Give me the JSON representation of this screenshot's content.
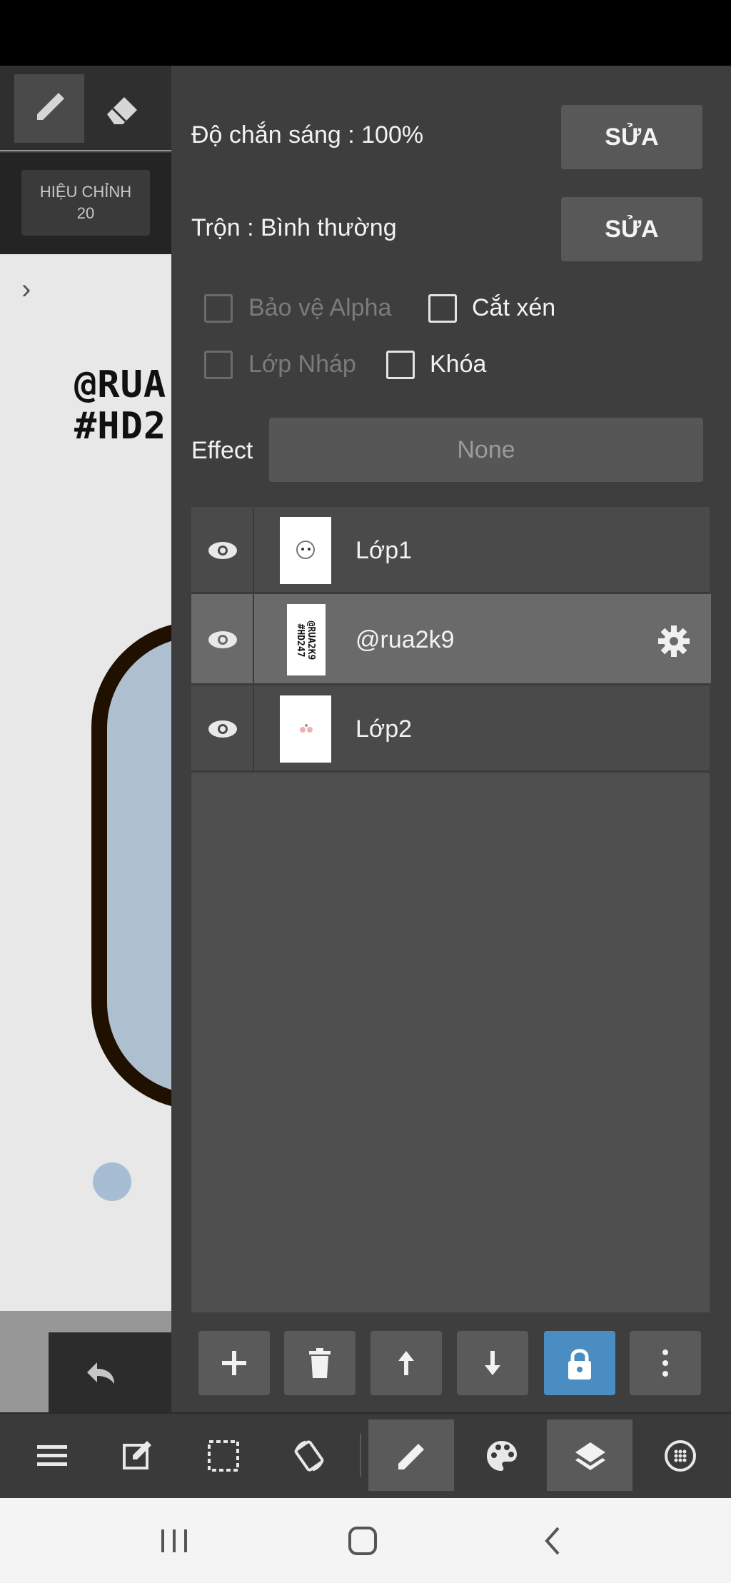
{
  "toolbar": {
    "correction_label": "HIỆU CHỈNH",
    "correction_value": "20"
  },
  "canvas": {
    "watermark_line1": "@RUA",
    "watermark_line2": "#HD2"
  },
  "layer_panel": {
    "opacity_label": "Độ chắn sáng : 100%",
    "opacity_edit": "SỬA",
    "blend_label": "Trộn : Bình thường",
    "blend_edit": "SỬA",
    "protect_alpha": "Bảo vệ Alpha",
    "clipping": "Cắt xén",
    "draft_layer": "Lớp Nháp",
    "lock": "Khóa",
    "effect_label": "Effect",
    "effect_value": "None"
  },
  "layers": [
    {
      "name": "Lớp1",
      "visible": true,
      "selected": false
    },
    {
      "name": "@rua2k9",
      "visible": true,
      "selected": true,
      "thumb_text": "@RUA2K9 #HD247"
    },
    {
      "name": "Lớp2",
      "visible": true,
      "selected": false
    }
  ],
  "colors": {
    "panel_bg": "#3e3e3e",
    "active_lock": "#4a8dc2"
  },
  "icons": {
    "layer_actions": [
      "plus-icon",
      "trash-icon",
      "arrow-up-icon",
      "arrow-down-icon",
      "lock-icon",
      "more-vertical-icon"
    ],
    "main_toolbar": [
      "menu-icon",
      "edit-icon",
      "selection-icon",
      "rotate-icon",
      "brush-icon",
      "palette-icon",
      "layers-icon",
      "material-icon"
    ],
    "nav": [
      "recent-apps-icon",
      "home-icon",
      "back-icon"
    ]
  }
}
